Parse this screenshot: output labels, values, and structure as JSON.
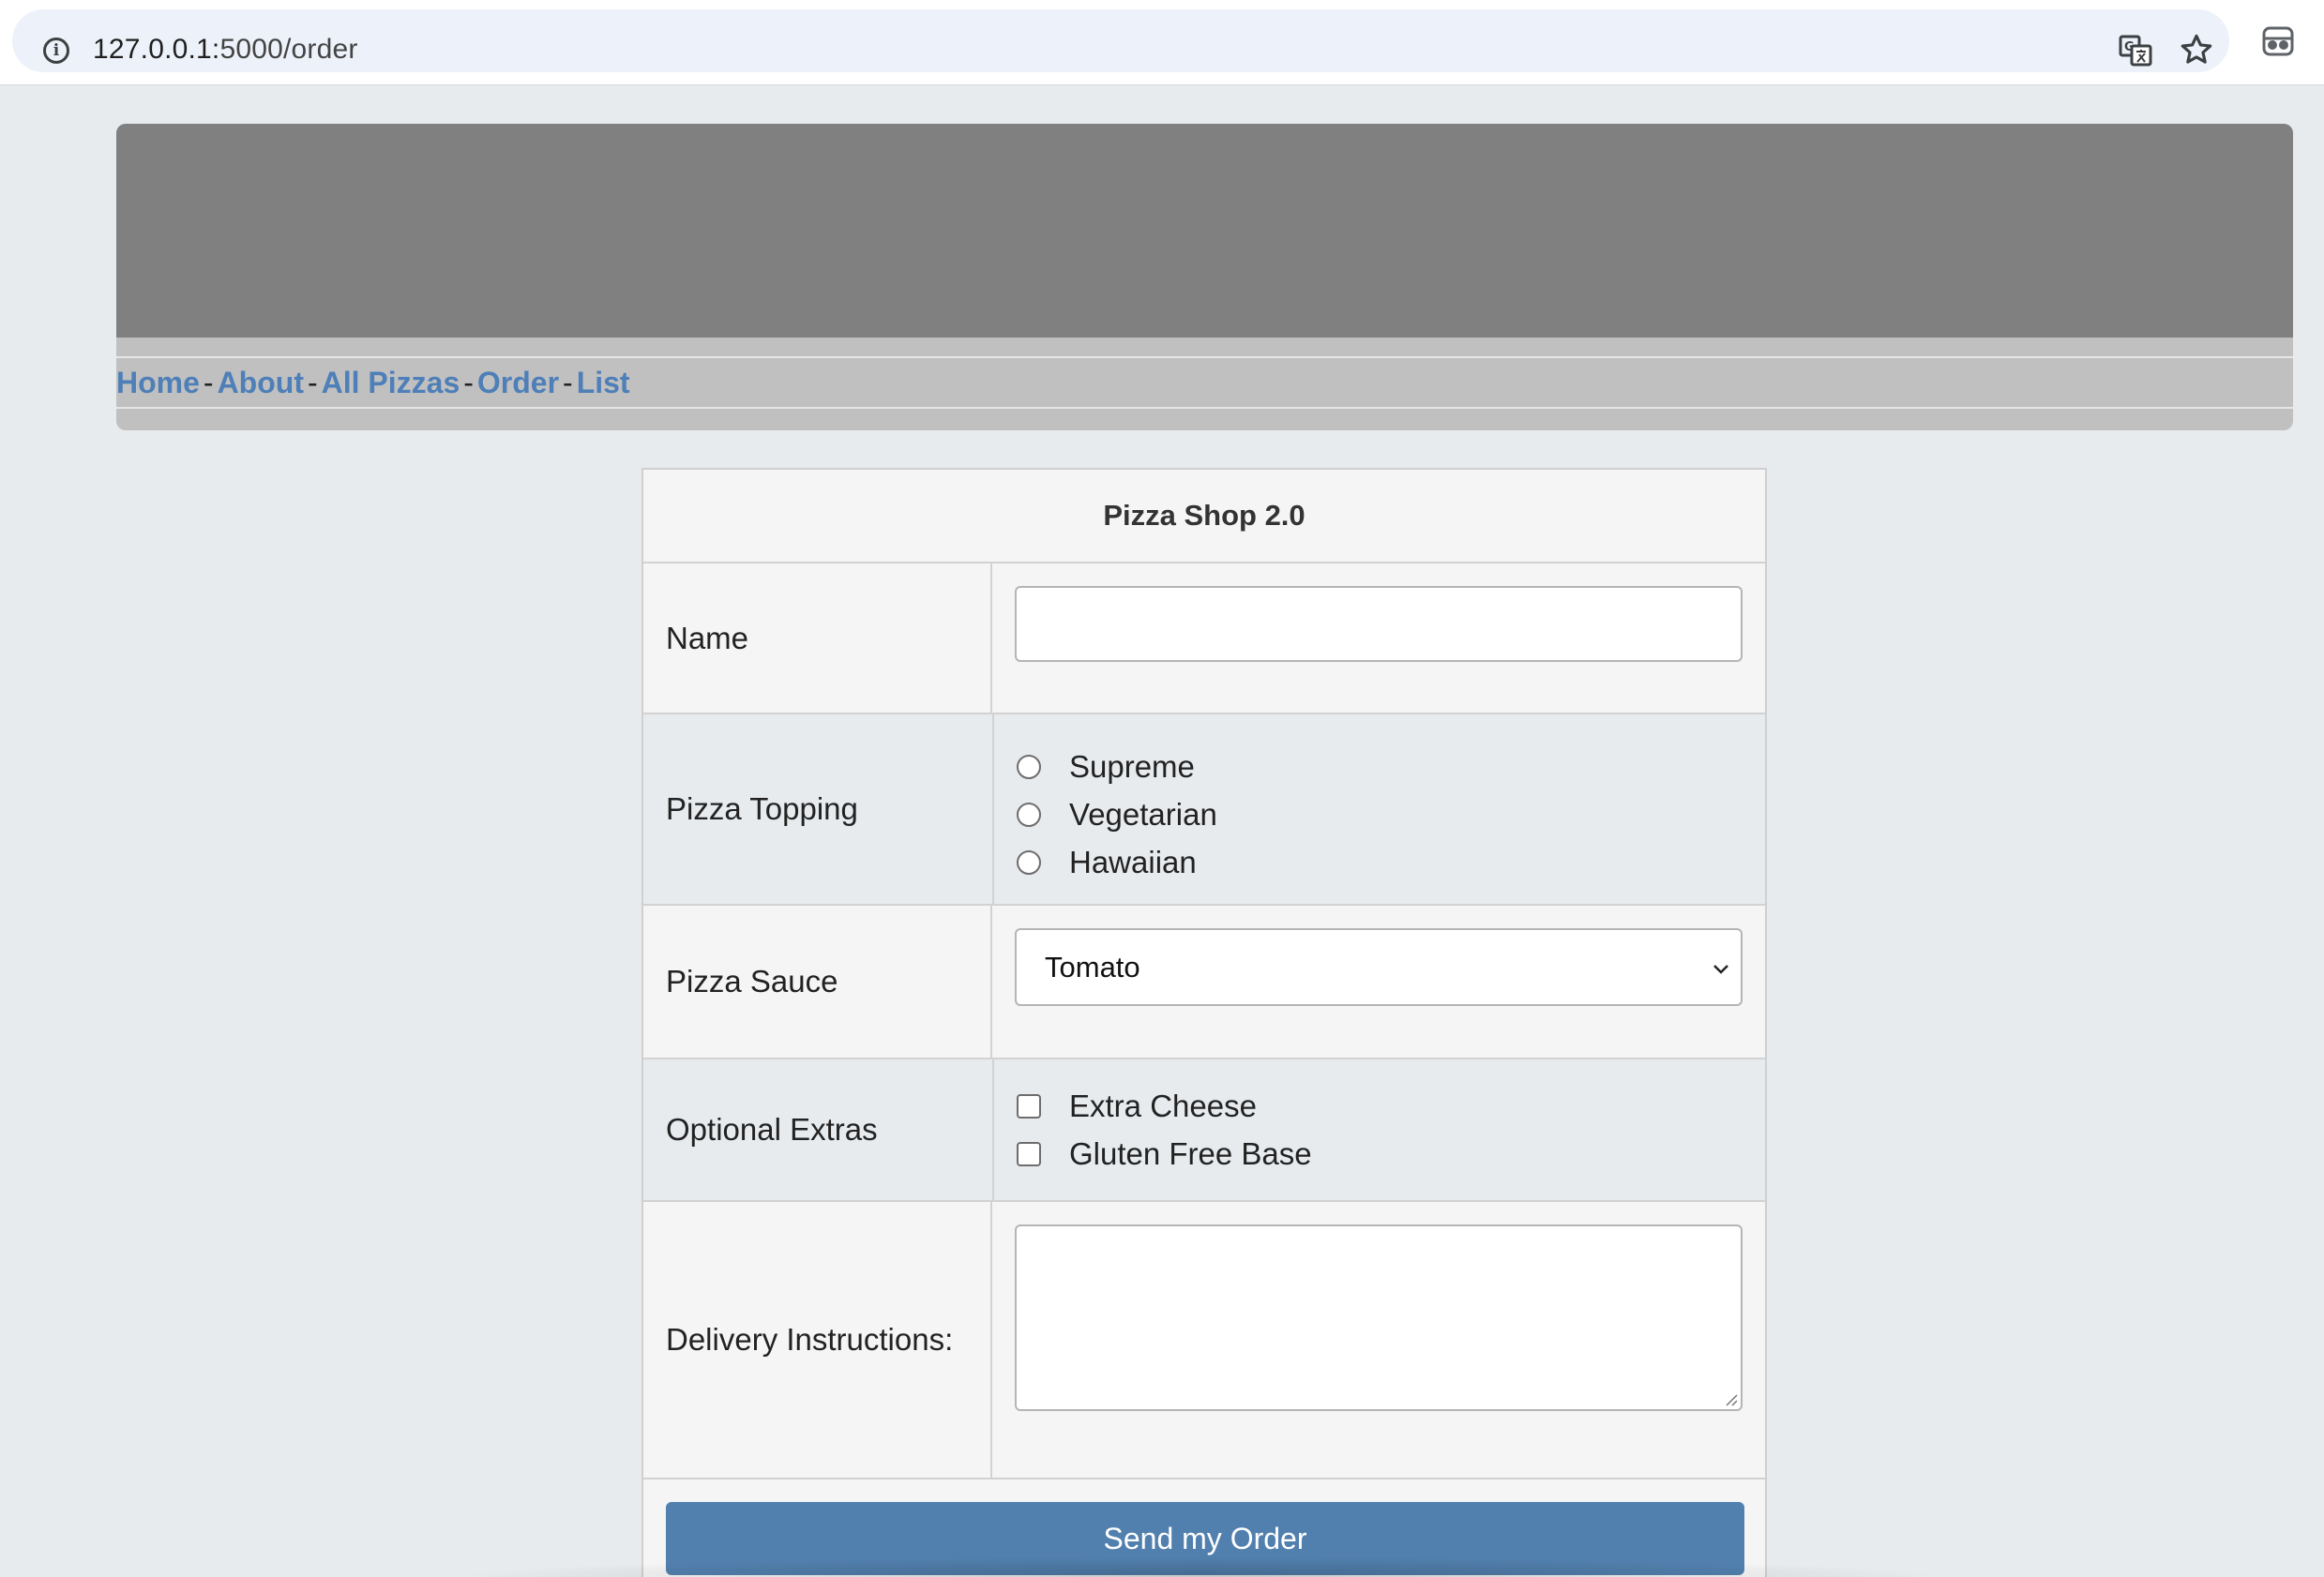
{
  "browser": {
    "url_host": "127.0.0.1:",
    "url_path": "5000/order",
    "icons": [
      "info-icon",
      "translate-icon",
      "star-icon",
      "profile-icon"
    ]
  },
  "nav": {
    "links": [
      "Home",
      "About",
      "All Pizzas",
      "Order",
      "List"
    ],
    "separator": "-"
  },
  "form": {
    "title": "Pizza Shop 2.0",
    "name_label": "Name",
    "name_value": "",
    "topping_label": "Pizza Topping",
    "toppings": [
      "Supreme",
      "Vegetarian",
      "Hawaiian"
    ],
    "sauce_label": "Pizza Sauce",
    "sauce_selected": "Tomato",
    "extras_label": "Optional Extras",
    "extras": [
      "Extra Cheese",
      "Gluten Free Base"
    ],
    "delivery_label": "Delivery Instructions:",
    "delivery_value": "",
    "submit_label": "Send my Order"
  },
  "colors": {
    "link": "#4e7fb8",
    "button": "#5280ae",
    "banner": "#808080",
    "nav_strip": "#c0c0c0",
    "page_bg": "#e8ebee"
  }
}
